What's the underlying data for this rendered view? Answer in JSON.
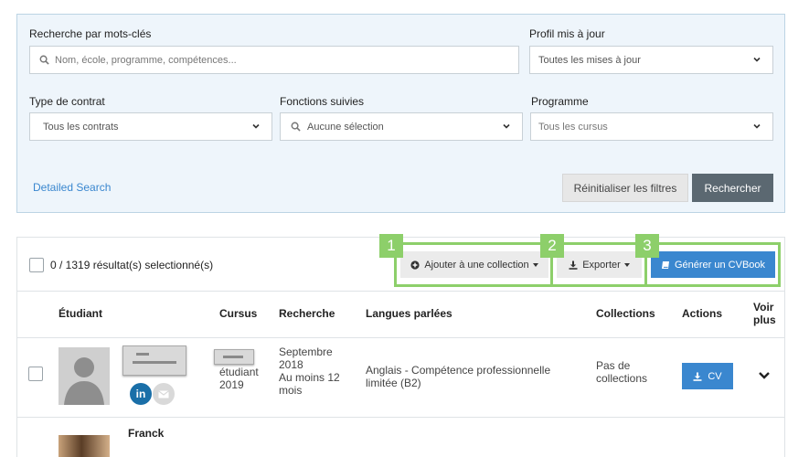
{
  "search": {
    "keywords_label": "Recherche par mots-clés",
    "keywords_placeholder": "Nom, école, programme, compétences...",
    "profile_label": "Profil mis à jour",
    "profile_value": "Toutes les mises à jour",
    "contract_label": "Type de contrat",
    "contract_value": "Tous les contrats",
    "functions_label": "Fonctions suivies",
    "functions_value": "Aucune sélection",
    "program_label": "Programme",
    "program_value": "Tous les cursus",
    "detailed_link": "Detailed Search",
    "reset_button": "Réinitialiser les filtres",
    "search_button": "Rechercher"
  },
  "toolbar": {
    "selection_count": "0 / 1319 résultat(s) selectionné(s)",
    "add_collection": "Ajouter à une collection",
    "export": "Exporter",
    "generate_cvbook": "Générer un CVBook",
    "badges": [
      "1",
      "2",
      "3"
    ]
  },
  "table": {
    "headers": {
      "student": "Étudiant",
      "cursus": "Cursus",
      "search": "Recherche",
      "languages": "Langues parlées",
      "collections": "Collections",
      "actions": "Actions",
      "more_line1": "Voir",
      "more_line2": "plus"
    },
    "rows": [
      {
        "cursus_status": "étudiant",
        "cursus_year": "2019",
        "search_line1": "Septembre",
        "search_line2": "2018",
        "search_line3": "Au moins 12",
        "search_line4": "mois",
        "languages_line1": "Anglais - Compétence professionnelle",
        "languages_line2": "limitée (B2)",
        "collections_line1": "Pas de",
        "collections_line2": "collections",
        "cv_button": "CV",
        "linkedin": "in"
      },
      {
        "name": "Franck"
      }
    ]
  },
  "colors": {
    "accent_blue": "#3a87cf",
    "highlight_green": "#8dcf6a",
    "dark_button": "#5b6871"
  }
}
